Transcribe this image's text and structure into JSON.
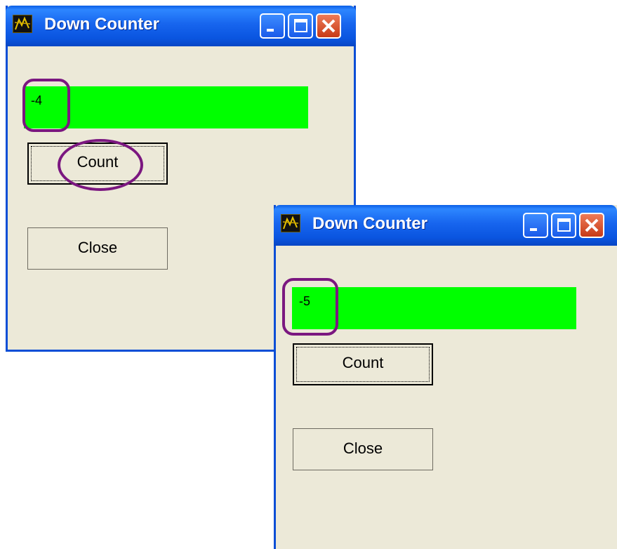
{
  "windows": [
    {
      "title": "Down Counter",
      "display_value": "-4",
      "count_label": "Count",
      "close_label": "Close"
    },
    {
      "title": "Down Counter",
      "display_value": "-5",
      "count_label": "Count",
      "close_label": "Close"
    }
  ],
  "colors": {
    "display_bg": "#00ff00",
    "annotation": "#7b1780",
    "titlebar": "#0a55e0"
  }
}
